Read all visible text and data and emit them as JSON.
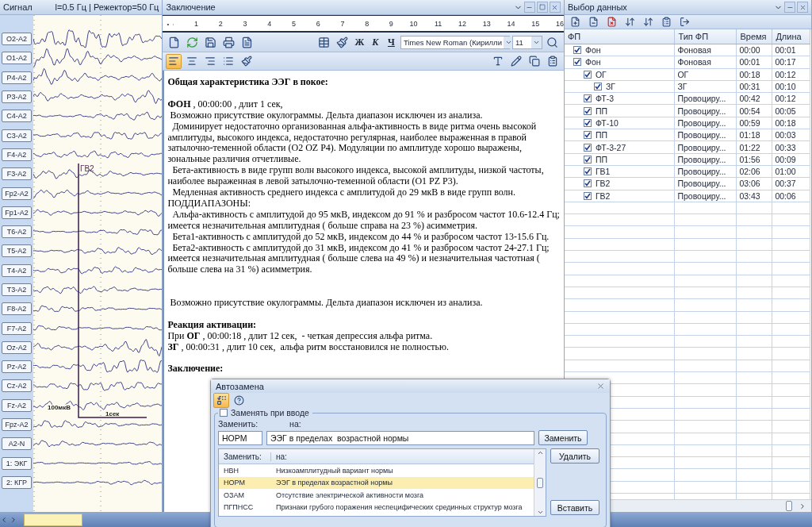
{
  "signal_panel": {
    "title": "Сигнал",
    "filter": "l=0.5 Гц | Режектор=50 Гц",
    "channels": [
      "O2-A2",
      "O1-A2",
      "P4-A2",
      "P3-A2",
      "C4-A2",
      "C3-A2",
      "F4-A2",
      "F3-A2",
      "Fp2-A2",
      "Fp1-A2",
      "T6-A2",
      "T5-A2",
      "T4-A2",
      "T3-A2",
      "F8-A2",
      "F7-A2",
      "Oz-A2",
      "Pz-A2",
      "Cz-A2",
      "Fz-A2",
      "Fpz-A2",
      "A2-N",
      "1: ЭКГ",
      "2: КГР"
    ],
    "marker": "ГВ2",
    "amp_scale": "100мкВ",
    "time_scale": "1сек"
  },
  "report_panel": {
    "title": "Заключение",
    "ruler": [
      "1",
      "2",
      "3",
      "4",
      "5",
      "6",
      "7",
      "8",
      "9",
      "10",
      "11",
      "12",
      "13",
      "14",
      "15",
      "16"
    ],
    "format_buttons": [
      "Ж",
      "К",
      "Ч"
    ],
    "font": "Times New Roman (Кирилли",
    "size": "11",
    "alignment": [
      {
        "kind": "left",
        "selected": true
      },
      {
        "kind": "center",
        "selected": false
      },
      {
        "kind": "right",
        "selected": false
      },
      {
        "kind": "list",
        "selected": false
      }
    ],
    "paragraphs": [
      {
        "kind": "heading",
        "text": "Общая характеристика ЭЭГ в покое:"
      },
      {
        "kind": "blank"
      },
      {
        "kind": "text",
        "text": "**ФОН** , 00:00:00 , длит 1 сек,"
      },
      {
        "kind": "text",
        "text": " Возможно присутствие окулограммы. Дельта диапазон исключен из анализа."
      },
      {
        "kind": "text",
        "text": "  Доминирует недостаточно организованная альфа-активность в виде ритма очень высокой амплитуды, высокого индекса, недостаточно регулярная, наиболее выраженная в правой затылочно-теменной области (O2 OZ P4). Модуляции по амплитуде хорошо выражены, зональные различия отчетливые."
      },
      {
        "kind": "text",
        "text": "  Бета-активность в виде групп волн высокого индекса, высокой амплитуды, низкой частоты, наиболее выраженная в левой затылочно-теменной области (O1 PZ P3)."
      },
      {
        "kind": "text",
        "text": "  Медленная активность среднего индекса с амплитудой до 29 мкВ в виде групп волн."
      },
      {
        "kind": "text",
        "text": "ПОДДИАПАЗОНЫ:"
      },
      {
        "kind": "text",
        "text": "  Альфа-активность с амплитудой до 95 мкВ, индексом до 91 % и разбросом частот 10.6-12.4 Гц; имеется незначительная амплитудная ( больше справа на 23 %) асимметрия."
      },
      {
        "kind": "text",
        "text": "  Бета1-активность с амплитудой до 52 мкВ, индексом до 44 % и разбросом частот 13-15.6 Гц."
      },
      {
        "kind": "text",
        "text": "  Бета2-активность с амплитудой до 31 мкВ, индексом до 41 % и разбросом частот 24-27.1 Гц; имеется незначительная амплитудная ( больше слева на 49 %) и незначительная частотная ( больше слева на 31 %) асимметрия."
      },
      {
        "kind": "blank"
      },
      {
        "kind": "blank"
      },
      {
        "kind": "text",
        "text": " Возможно присутствие окулограммы. Дельта диапазон исключен из анализа."
      },
      {
        "kind": "blank"
      },
      {
        "kind": "heading",
        "text": "Реакция активации:"
      },
      {
        "kind": "text",
        "text": "При **ОГ** , 00:00:18 , длит 12 сек,  - четкая депрессия альфа ритма."
      },
      {
        "kind": "text",
        "text": "**ЗГ** , 00:00:31 , длит 10 сек,  альфа ритм восстановился не полностью."
      },
      {
        "kind": "blank"
      },
      {
        "kind": "heading",
        "text": "Заключение:"
      }
    ]
  },
  "data_panel": {
    "title": "Выбор данных",
    "columns": [
      "ФП",
      "Тип ФП",
      "Время",
      "Длина"
    ],
    "rows": [
      {
        "name": "Фон",
        "type": "Фоновая",
        "time": "00:00",
        "length": "00:01",
        "checked": true
      },
      {
        "name": "Фон",
        "type": "Фоновая",
        "time": "00:01",
        "length": "00:17",
        "checked": true,
        "children": [
          {
            "name": "ОГ",
            "type": "ОГ",
            "time": "00:18",
            "length": "00:12",
            "checked": true,
            "children": [
              {
                "name": "ЗГ",
                "type": "ЗГ",
                "time": "00:31",
                "length": "00:10",
                "checked": true
              }
            ]
          },
          {
            "name": "ФТ-3",
            "type": "Провоциру...",
            "time": "00:42",
            "length": "00:12",
            "checked": true
          },
          {
            "name": "ПП",
            "type": "Провоциру...",
            "time": "00:54",
            "length": "00:05",
            "checked": true
          },
          {
            "name": "ФТ-10",
            "type": "Провоциру...",
            "time": "00:59",
            "length": "00:18",
            "checked": true
          },
          {
            "name": "ПП",
            "type": "Провоциру...",
            "time": "01:18",
            "length": "00:03",
            "checked": true
          },
          {
            "name": "ФТ-3-27",
            "type": "Провоциру...",
            "time": "01:22",
            "length": "00:33",
            "checked": true
          },
          {
            "name": "ПП",
            "type": "Провоциру...",
            "time": "01:56",
            "length": "00:09",
            "checked": true
          },
          {
            "name": "ГВ1",
            "type": "Провоциру...",
            "time": "02:06",
            "length": "01:00",
            "checked": true
          },
          {
            "name": "ГВ2",
            "type": "Провоциру...",
            "time": "03:06",
            "length": "00:37",
            "checked": true
          },
          {
            "name": "ГВ2",
            "type": "Провоциру...",
            "time": "03:43",
            "length": "00:06",
            "checked": true
          }
        ]
      }
    ]
  },
  "dialog": {
    "title": "Автозамена",
    "tools": [
      {
        "kind": "replace",
        "selected": true
      },
      {
        "kind": "help",
        "selected": false
      }
    ],
    "replace_on_input": {
      "label": "Заменять при вводе",
      "checked": false
    },
    "replace_label": "Заменить:",
    "with_label": "на:",
    "replace_value": "НОРМ",
    "with_value": "ЭЭГ в пределах  возрастной нормы",
    "buttons": [
      "Заменить",
      "Удалить",
      "Вставить"
    ],
    "list": {
      "columns": [
        "Заменить:",
        "на:"
      ],
      "rows": [
        {
          "key": "НВН",
          "value": "Низкоамплитудный  вариант нормы",
          "selected": false
        },
        {
          "key": "НОРМ",
          "value": "ЭЭГ в пределах  возрастной нормы",
          "selected": true
        },
        {
          "key": "ОЗАМ",
          "value": "Отсутствие  электрической активности мозга",
          "selected": false
        },
        {
          "key": "ПГПНСС",
          "value": "Признаки  грубого  поражения  неспецифических срединных структур мозга",
          "selected": false
        }
      ]
    }
  }
}
